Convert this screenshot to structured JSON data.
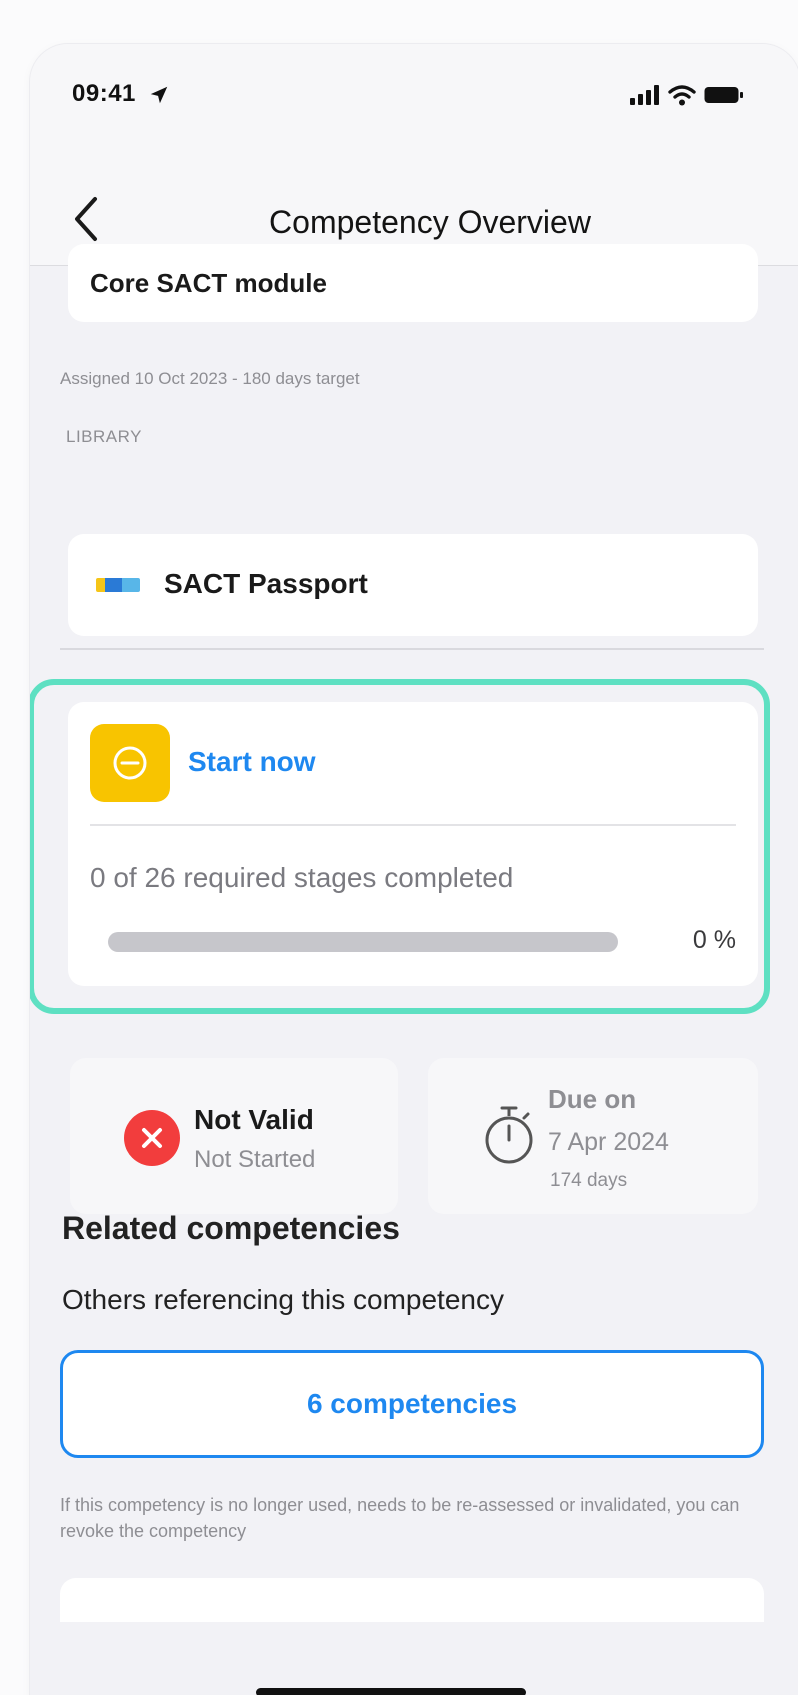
{
  "status_bar": {
    "time": "09:41",
    "icons": [
      "location-arrow-icon",
      "cellular-signal-icon",
      "wifi-icon",
      "battery-icon"
    ]
  },
  "nav": {
    "title": "Competency Overview",
    "back_icon": "chevron-left-icon"
  },
  "module": {
    "name": "Core SACT module",
    "assigned": "Assigned 10 Oct 2023 - 180 days target"
  },
  "library": {
    "label": "LIBRARY",
    "name": "SACT Passport",
    "logo_icon": "library-logo-icon"
  },
  "progress": {
    "status_icon": "minus-circle-icon",
    "status_color": "#f8c400",
    "action_label": "Start now",
    "stages_text": "0 of 26 required stages completed",
    "percent_value": 0,
    "percent_label": "0 %"
  },
  "validity": {
    "icon": "x-circle-icon",
    "icon_color": "#f23d3d",
    "title": "Not Valid",
    "subtitle": "Not Started"
  },
  "due": {
    "icon": "stopwatch-icon",
    "title": "Due on",
    "date": "7 Apr 2024",
    "days_left": "174 days"
  },
  "related": {
    "title": "Related competencies",
    "subtitle": "Others referencing this competency",
    "button_label": "6 competencies",
    "note": "If this competency is no longer used, needs to be re-assessed or invalidated, you can revoke the competency"
  },
  "colors": {
    "accent": "#1e88f0",
    "highlight": "#5ee0c2",
    "background": "#f2f2f6"
  }
}
